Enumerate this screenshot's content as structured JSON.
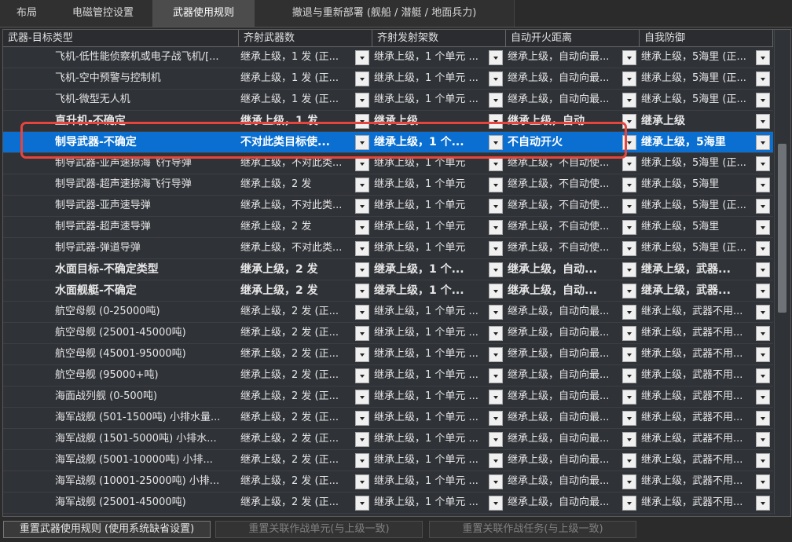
{
  "tabs": [
    "布局",
    "电磁管控设置",
    "武器使用规则",
    "撤退与重新部署 (舰船 / 潜艇 / 地面兵力)"
  ],
  "columns": [
    "武器-目标类型",
    "齐射武器数",
    "齐射发射架数",
    "自动开火距离",
    "自我防御"
  ],
  "rows": [
    {
      "name": "飞机-低性能侦察机或电子战飞机/[...",
      "c1": "继承上级，1 发 (正...",
      "c2": "继承上级，1 个单元 ...",
      "c3": "继承上级，自动向最...",
      "c4": "继承上级，5海里 (正..."
    },
    {
      "name": "飞机-空中预警与控制机",
      "c1": "继承上级，1 发 (正...",
      "c2": "继承上级，1 个单元 ...",
      "c3": "继承上级，自动向最...",
      "c4": "继承上级，5海里 (正..."
    },
    {
      "name": "飞机-微型无人机",
      "c1": "继承上级，1 发 (正...",
      "c2": "继承上级，1 个单元 ...",
      "c3": "继承上级，自动向最...",
      "c4": "继承上级，5海里 (正..."
    },
    {
      "name": "直升机-不确定",
      "c1": "继承上级，1 发",
      "c2": "继承上级",
      "c3": "继承上级，自动...",
      "c4": "继承上级",
      "bold": true
    },
    {
      "name": "制导武器-不确定",
      "c1": "不对此类目标使...",
      "c2": "继承上级，1 个...",
      "c3": "不自动开火",
      "c4": "继承上级，5海里",
      "bold": true,
      "selected": true
    },
    {
      "name": "制导武器-亚声速掠海飞行导弹",
      "c1": "继承上级，不对此类...",
      "c2": "继承上级，1 个单元",
      "c3": "继承上级，不自动使...",
      "c4": "继承上级，5海里 (正..."
    },
    {
      "name": "制导武器-超声速掠海飞行导弹",
      "c1": "继承上级，2 发",
      "c2": "继承上级，1 个单元",
      "c3": "继承上级，不自动使...",
      "c4": "继承上级，5海里"
    },
    {
      "name": "制导武器-亚声速导弹",
      "c1": "继承上级，不对此类...",
      "c2": "继承上级，1 个单元",
      "c3": "继承上级，不自动使...",
      "c4": "继承上级，5海里 (正..."
    },
    {
      "name": "制导武器-超声速导弹",
      "c1": "继承上级，2 发",
      "c2": "继承上级，1 个单元",
      "c3": "继承上级，不自动使...",
      "c4": "继承上级，5海里"
    },
    {
      "name": "制导武器-弹道导弹",
      "c1": "继承上级，不对此类...",
      "c2": "继承上级，1 个单元",
      "c3": "继承上级，不自动使...",
      "c4": "继承上级，5海里 (正..."
    },
    {
      "name": "水面目标-不确定类型",
      "c1": "继承上级，2 发",
      "c2": "继承上级，1 个...",
      "c3": "继承上级，自动...",
      "c4": "继承上级，武器...",
      "bold": true
    },
    {
      "name": "水面舰艇-不确定",
      "c1": "继承上级，2 发",
      "c2": "继承上级，1 个...",
      "c3": "继承上级，自动...",
      "c4": "继承上级，武器...",
      "bold": true
    },
    {
      "name": "航空母舰 (0-25000吨)",
      "c1": "继承上级，2 发 (正...",
      "c2": "继承上级，1 个单元 ...",
      "c3": "继承上级，自动向最...",
      "c4": "继承上级，武器不用..."
    },
    {
      "name": "航空母舰 (25001-45000吨)",
      "c1": "继承上级，2 发 (正...",
      "c2": "继承上级，1 个单元 ...",
      "c3": "继承上级，自动向最...",
      "c4": "继承上级，武器不用..."
    },
    {
      "name": "航空母舰 (45001-95000吨)",
      "c1": "继承上级，2 发 (正...",
      "c2": "继承上级，1 个单元 ...",
      "c3": "继承上级，自动向最...",
      "c4": "继承上级，武器不用..."
    },
    {
      "name": "航空母舰 (95000+吨)",
      "c1": "继承上级，2 发 (正...",
      "c2": "继承上级，1 个单元 ...",
      "c3": "继承上级，自动向最...",
      "c4": "继承上级，武器不用..."
    },
    {
      "name": "海面战列舰 (0-500吨)",
      "c1": "继承上级，2 发 (正...",
      "c2": "继承上级，1 个单元 ...",
      "c3": "继承上级，自动向最...",
      "c4": "继承上级，武器不用..."
    },
    {
      "name": "海军战舰 (501-1500吨) 小排水量...",
      "c1": "继承上级，2 发 (正...",
      "c2": "继承上级，1 个单元 ...",
      "c3": "继承上级，自动向最...",
      "c4": "继承上级，武器不用..."
    },
    {
      "name": "海军战舰 (1501-5000吨) 小排水...",
      "c1": "继承上级，2 发 (正...",
      "c2": "继承上级，1 个单元 ...",
      "c3": "继承上级，自动向最...",
      "c4": "继承上级，武器不用..."
    },
    {
      "name": "海军战舰 (5001-10000吨) 小排...",
      "c1": "继承上级，2 发 (正...",
      "c2": "继承上级，1 个单元 ...",
      "c3": "继承上级，自动向最...",
      "c4": "继承上级，武器不用..."
    },
    {
      "name": "海军战舰 (10001-25000吨) 小排...",
      "c1": "继承上级，2 发 (正...",
      "c2": "继承上级，1 个单元 ...",
      "c3": "继承上级，自动向最...",
      "c4": "继承上级，武器不用..."
    },
    {
      "name": "海军战舰 (25001-45000吨)",
      "c1": "继承上级，2 发 (正...",
      "c2": "继承上级，1 个单元 ...",
      "c3": "继承上级，自动向最...",
      "c4": "继承上级，武器不用..."
    }
  ],
  "buttons": [
    "重置武器使用规则 (使用系统缺省设置)",
    "重置关联作战单元(与上级一致)",
    "重置关联作战任务(与上级一致)"
  ]
}
